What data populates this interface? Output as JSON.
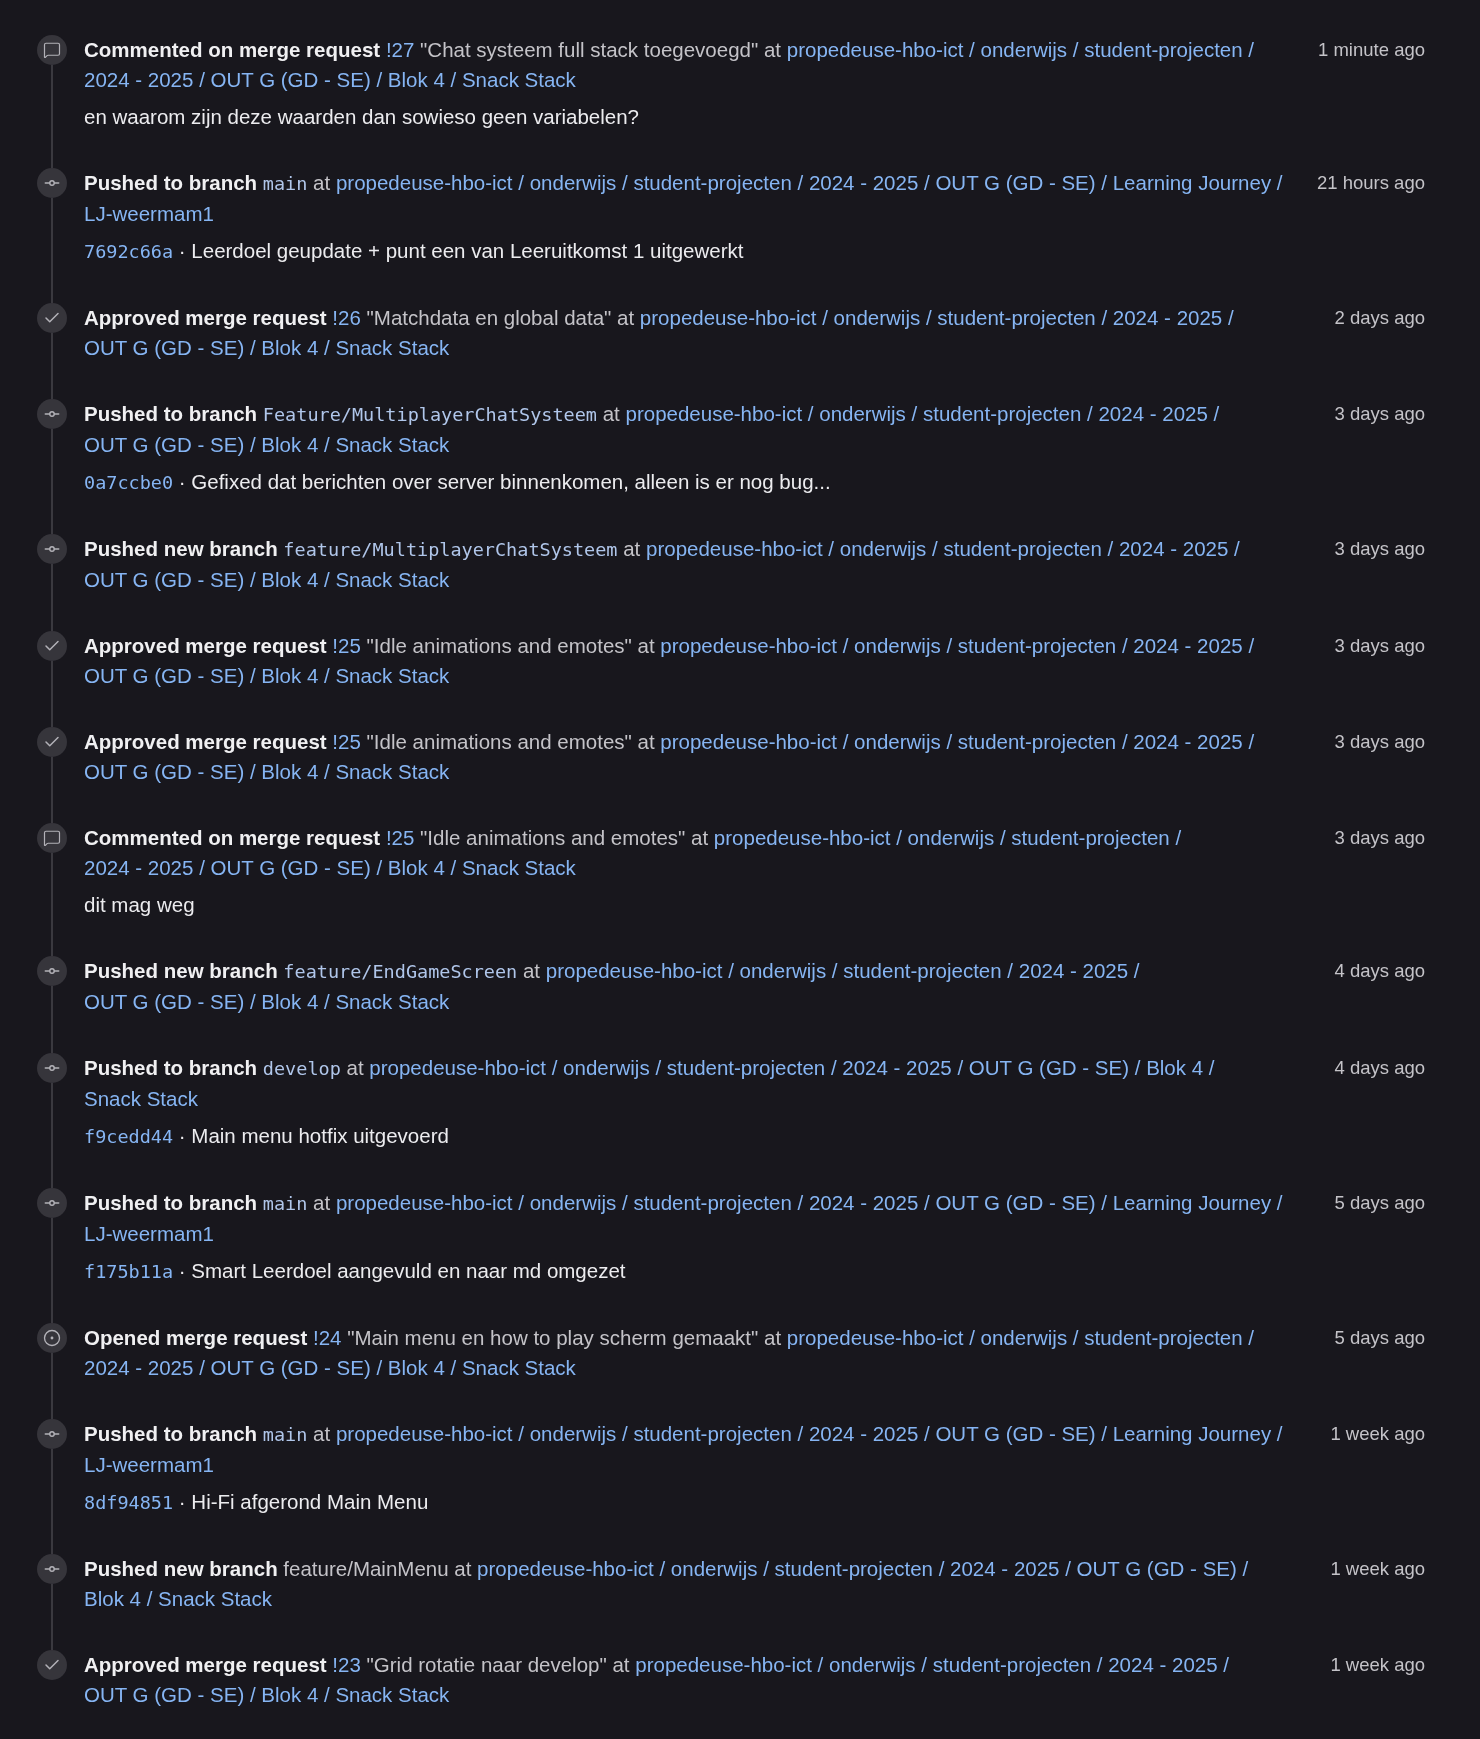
{
  "path_separator": "/",
  "events": [
    {
      "kind": "comment",
      "action": "Commented on merge request",
      "mr": {
        "ref": "!27",
        "title": "\"Chat systeem full stack toegevoegd\""
      },
      "at": "at",
      "project": [
        "propedeuse-hbo-ict",
        "onderwijs",
        "student-projecten",
        "2024 - 2025",
        "OUT G (GD - SE)",
        "Blok 4",
        "Snack Stack"
      ],
      "time": "1 minute ago",
      "note": "en waarom zijn deze waarden dan sowieso geen variabelen?"
    },
    {
      "kind": "push",
      "action": "Pushed to branch",
      "ref": {
        "text": "main",
        "mono": true
      },
      "at": "at",
      "project": [
        "propedeuse-hbo-ict",
        "onderwijs",
        "student-projecten",
        "2024 - 2025",
        "OUT G (GD - SE)",
        "Learning Journey",
        "LJ-weermam1"
      ],
      "time": "21 hours ago",
      "commit": {
        "sha": "7692c66a",
        "separator": "·",
        "message": "Leerdoel geupdate + punt een van Leeruitkomst 1 uitgewerkt"
      }
    },
    {
      "kind": "approved",
      "action": "Approved merge request",
      "mr": {
        "ref": "!26",
        "title": "\"Matchdata en global data\""
      },
      "at": "at",
      "project": [
        "propedeuse-hbo-ict",
        "onderwijs",
        "student-projecten",
        "2024 - 2025",
        "OUT G (GD - SE)",
        "Blok 4",
        "Snack Stack"
      ],
      "time": "2 days ago"
    },
    {
      "kind": "push",
      "action": "Pushed to branch",
      "ref": {
        "text": "Feature/MultiplayerChatSysteem",
        "mono": true
      },
      "at": "at",
      "project": [
        "propedeuse-hbo-ict",
        "onderwijs",
        "student-projecten",
        "2024 - 2025",
        "OUT G (GD - SE)",
        "Blok 4",
        "Snack Stack"
      ],
      "time": "3 days ago",
      "commit": {
        "sha": "0a7ccbe0",
        "separator": "·",
        "message": "Gefixed dat berichten over server binnenkomen, alleen is er nog bug..."
      }
    },
    {
      "kind": "push",
      "action": "Pushed new branch",
      "ref": {
        "text": "feature/MultiplayerChatSysteem",
        "mono": true
      },
      "at": "at",
      "project": [
        "propedeuse-hbo-ict",
        "onderwijs",
        "student-projecten",
        "2024 - 2025",
        "OUT G (GD - SE)",
        "Blok 4",
        "Snack Stack"
      ],
      "time": "3 days ago"
    },
    {
      "kind": "approved",
      "action": "Approved merge request",
      "mr": {
        "ref": "!25",
        "title": "\"Idle animations and emotes\""
      },
      "at": "at",
      "project": [
        "propedeuse-hbo-ict",
        "onderwijs",
        "student-projecten",
        "2024 - 2025",
        "OUT G (GD - SE)",
        "Blok 4",
        "Snack Stack"
      ],
      "time": "3 days ago"
    },
    {
      "kind": "approved",
      "action": "Approved merge request",
      "mr": {
        "ref": "!25",
        "title": "\"Idle animations and emotes\""
      },
      "at": "at",
      "project": [
        "propedeuse-hbo-ict",
        "onderwijs",
        "student-projecten",
        "2024 - 2025",
        "OUT G (GD - SE)",
        "Blok 4",
        "Snack Stack"
      ],
      "time": "3 days ago"
    },
    {
      "kind": "comment",
      "action": "Commented on merge request",
      "mr": {
        "ref": "!25",
        "title": "\"Idle animations and emotes\""
      },
      "at": "at",
      "project": [
        "propedeuse-hbo-ict",
        "onderwijs",
        "student-projecten",
        "2024 - 2025",
        "OUT G (GD - SE)",
        "Blok 4",
        "Snack Stack"
      ],
      "time": "3 days ago",
      "note": "dit mag weg"
    },
    {
      "kind": "push",
      "action": "Pushed new branch",
      "ref": {
        "text": "feature/EndGameScreen",
        "mono": true
      },
      "at": "at",
      "project": [
        "propedeuse-hbo-ict",
        "onderwijs",
        "student-projecten",
        "2024 - 2025",
        "OUT G (GD - SE)",
        "Blok 4",
        "Snack Stack"
      ],
      "time": "4 days ago"
    },
    {
      "kind": "push",
      "action": "Pushed to branch",
      "ref": {
        "text": "develop",
        "mono": true
      },
      "at": "at",
      "project": [
        "propedeuse-hbo-ict",
        "onderwijs",
        "student-projecten",
        "2024 - 2025",
        "OUT G (GD - SE)",
        "Blok 4",
        "Snack Stack"
      ],
      "time": "4 days ago",
      "commit": {
        "sha": "f9cedd44",
        "separator": "·",
        "message": "Main menu hotfix uitgevoerd"
      }
    },
    {
      "kind": "push",
      "action": "Pushed to branch",
      "ref": {
        "text": "main",
        "mono": true
      },
      "at": "at",
      "project": [
        "propedeuse-hbo-ict",
        "onderwijs",
        "student-projecten",
        "2024 - 2025",
        "OUT G (GD - SE)",
        "Learning Journey",
        "LJ-weermam1"
      ],
      "time": "5 days ago",
      "commit": {
        "sha": "f175b11a",
        "separator": "·",
        "message": "Smart Leerdoel aangevuld en naar md omgezet"
      }
    },
    {
      "kind": "opened",
      "action": "Opened merge request",
      "mr": {
        "ref": "!24",
        "title": "\"Main menu en how to play scherm gemaakt\""
      },
      "at": "at",
      "project": [
        "propedeuse-hbo-ict",
        "onderwijs",
        "student-projecten",
        "2024 - 2025",
        "OUT G (GD - SE)",
        "Blok 4",
        "Snack Stack"
      ],
      "time": "5 days ago"
    },
    {
      "kind": "push",
      "action": "Pushed to branch",
      "ref": {
        "text": "main",
        "mono": true
      },
      "at": "at",
      "project": [
        "propedeuse-hbo-ict",
        "onderwijs",
        "student-projecten",
        "2024 - 2025",
        "OUT G (GD - SE)",
        "Learning Journey",
        "LJ-weermam1"
      ],
      "time": "1 week ago",
      "commit": {
        "sha": "8df94851",
        "separator": "·",
        "message": "Hi-Fi afgerond Main Menu"
      }
    },
    {
      "kind": "push",
      "action": "Pushed new branch",
      "ref": {
        "text": "feature/MainMenu",
        "mono": false
      },
      "at": "at",
      "project": [
        "propedeuse-hbo-ict",
        "onderwijs",
        "student-projecten",
        "2024 - 2025",
        "OUT G (GD - SE)",
        "Blok 4",
        "Snack Stack"
      ],
      "time": "1 week ago"
    },
    {
      "kind": "approved",
      "action": "Approved merge request",
      "mr": {
        "ref": "!23",
        "title": "\"Grid rotatie naar develop\""
      },
      "at": "at",
      "project": [
        "propedeuse-hbo-ict",
        "onderwijs",
        "student-projecten",
        "2024 - 2025",
        "OUT G (GD - SE)",
        "Blok 4",
        "Snack Stack"
      ],
      "time": "1 week ago"
    }
  ]
}
